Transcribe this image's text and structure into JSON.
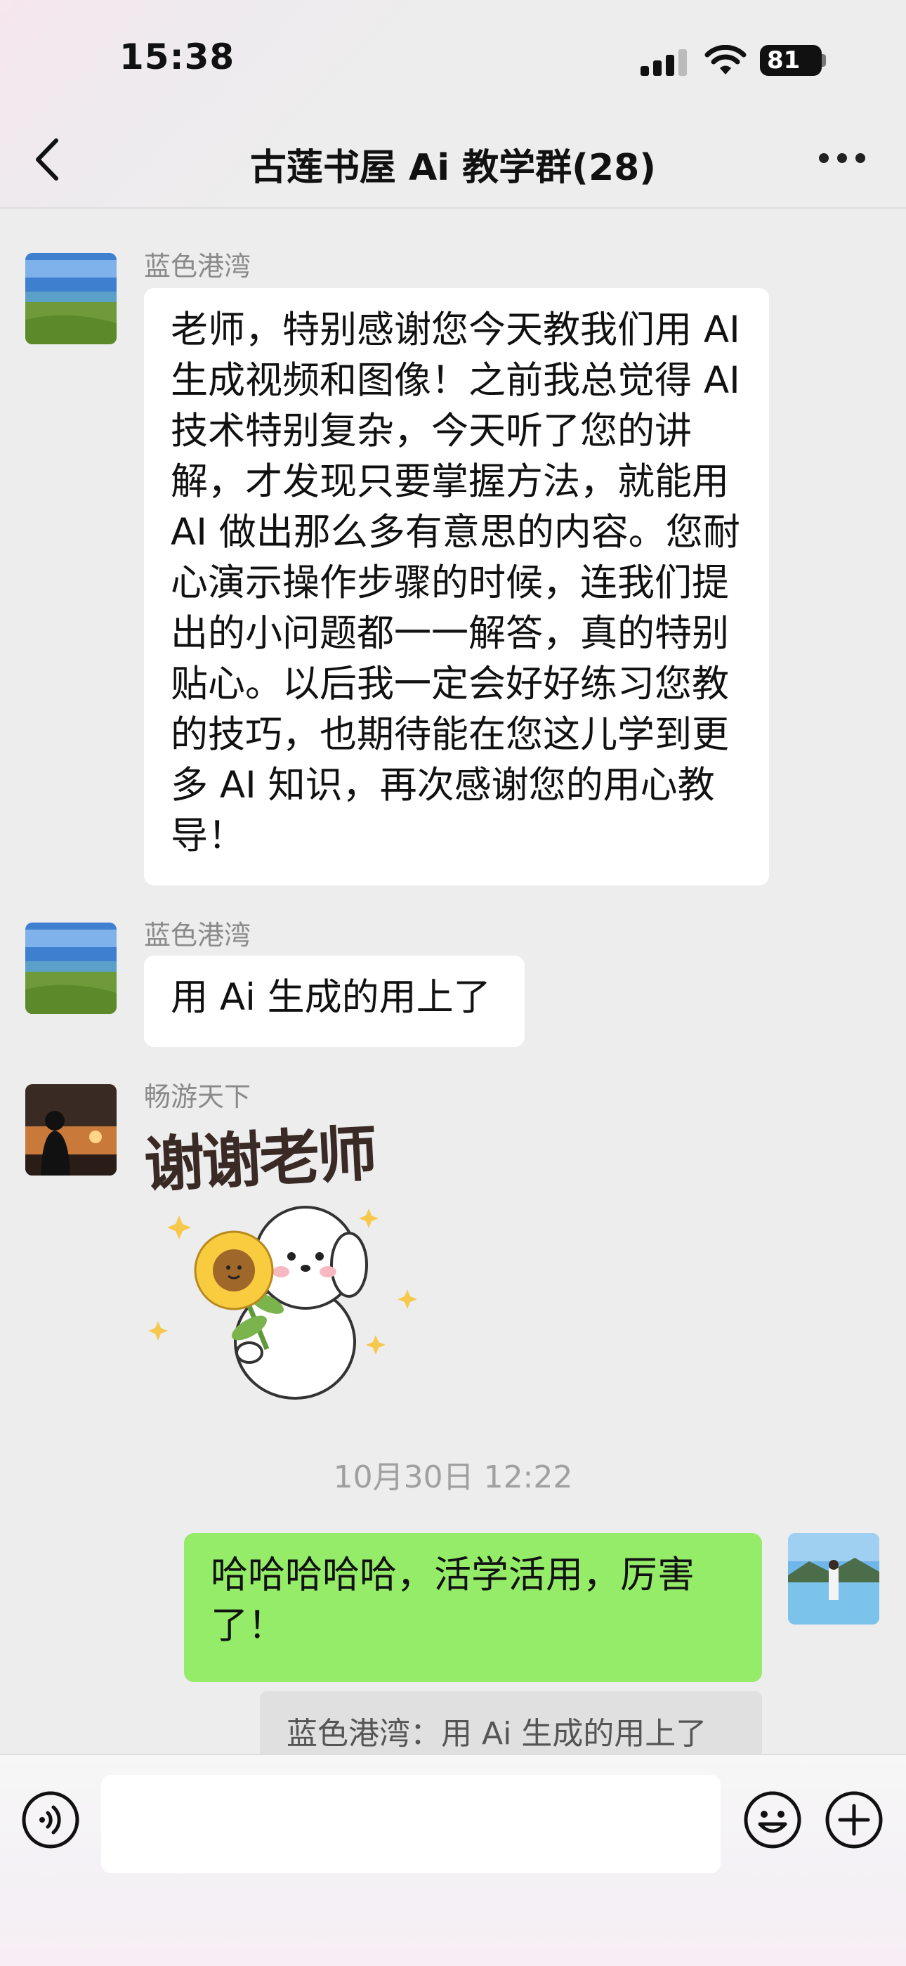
{
  "status_bar": {
    "time": "15:38",
    "battery": "81"
  },
  "nav": {
    "title": "古莲书屋 Ai 教学群(28)",
    "back_icon": "chevron-left-icon",
    "more_icon": "more-icon"
  },
  "messages": [
    {
      "sender": "蓝色港湾",
      "text": "老师，特别感谢您今天教我们用 AI 生成视频和图像！之前我总觉得 AI 技术特别复杂，今天听了您的讲解，才发现只要掌握方法，就能用 AI 做出那么多有意思的内容。您耐心演示操作步骤的时候，连我们提出的小问题都一一解答，真的特别贴心。以后我一定会好好练习您教的技巧，也期待能在您这儿学到更多 AI 知识，再次感谢您的用心教导！"
    },
    {
      "sender": "蓝色港湾",
      "text": "用 Ai 生成的用上了"
    },
    {
      "sender": "畅游天下",
      "sticker_text": "谢谢老师"
    }
  ],
  "timestamp": "10月30日 12:22",
  "my_message": {
    "text": "哈哈哈哈哈，活学活用，厉害了！",
    "quote": "蓝色港湾：用 Ai 生成的用上了"
  },
  "colors": {
    "my_bubble": "#95ec69",
    "other_bubble": "#ffffff",
    "background": "#ededed"
  },
  "input_bar": {
    "voice_icon": "voice-icon",
    "emoji_icon": "emoji-icon",
    "plus_icon": "plus-icon"
  }
}
